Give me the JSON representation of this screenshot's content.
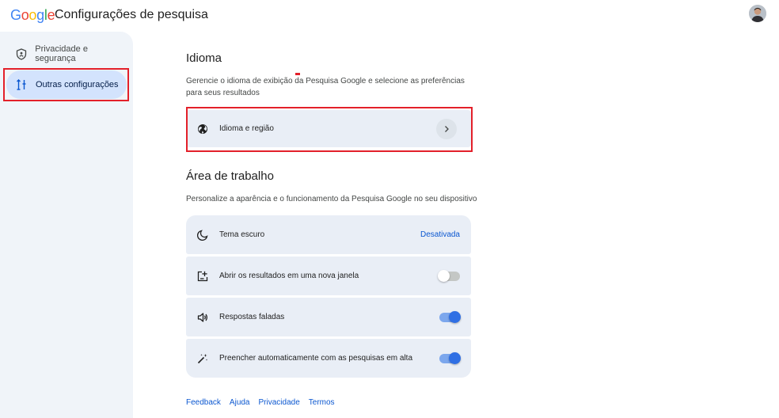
{
  "header": {
    "logo_letters": [
      {
        "char": "G",
        "color": "#4285F4"
      },
      {
        "char": "o",
        "color": "#EA4335"
      },
      {
        "char": "o",
        "color": "#FBBC05"
      },
      {
        "char": "g",
        "color": "#4285F4"
      },
      {
        "char": "l",
        "color": "#34A853"
      },
      {
        "char": "e",
        "color": "#EA4335"
      }
    ],
    "title": "Configurações de pesquisa"
  },
  "sidebar": {
    "items": [
      {
        "label": "Privacidade e segurança",
        "icon": "shield-icon",
        "active": false
      },
      {
        "label": "Outras configurações",
        "icon": "tune-icon",
        "active": true
      }
    ]
  },
  "main": {
    "idioma": {
      "title": "Idioma",
      "description": "Gerencie o idioma de exibição da Pesquisa Google e selecione as preferências para seus resultados",
      "row": {
        "label": "Idioma e região",
        "icon": "globe-icon"
      }
    },
    "workspace": {
      "title": "Área de trabalho",
      "description": "Personalize a aparência e o funcionamento da Pesquisa Google no seu dispositivo",
      "rows": [
        {
          "label": "Tema escuro",
          "icon": "moon-icon",
          "value": "Desativada"
        },
        {
          "label": "Abrir os resultados em uma nova janela",
          "icon": "new-window-icon",
          "toggle": false
        },
        {
          "label": "Respostas faladas",
          "icon": "speaker-icon",
          "toggle": true
        },
        {
          "label": "Preencher automaticamente com as pesquisas em alta",
          "icon": "magic-wand-icon",
          "toggle": true
        }
      ]
    }
  },
  "footer": {
    "links": [
      "Feedback",
      "Ajuda",
      "Privacidade",
      "Termos"
    ]
  },
  "colors": {
    "accent": "#0b57d0",
    "highlight_box": "#e3202a",
    "sidebar_bg": "#f0f4f9",
    "card_bg": "#e9eef6",
    "active_item_bg": "#d3e3fd"
  }
}
